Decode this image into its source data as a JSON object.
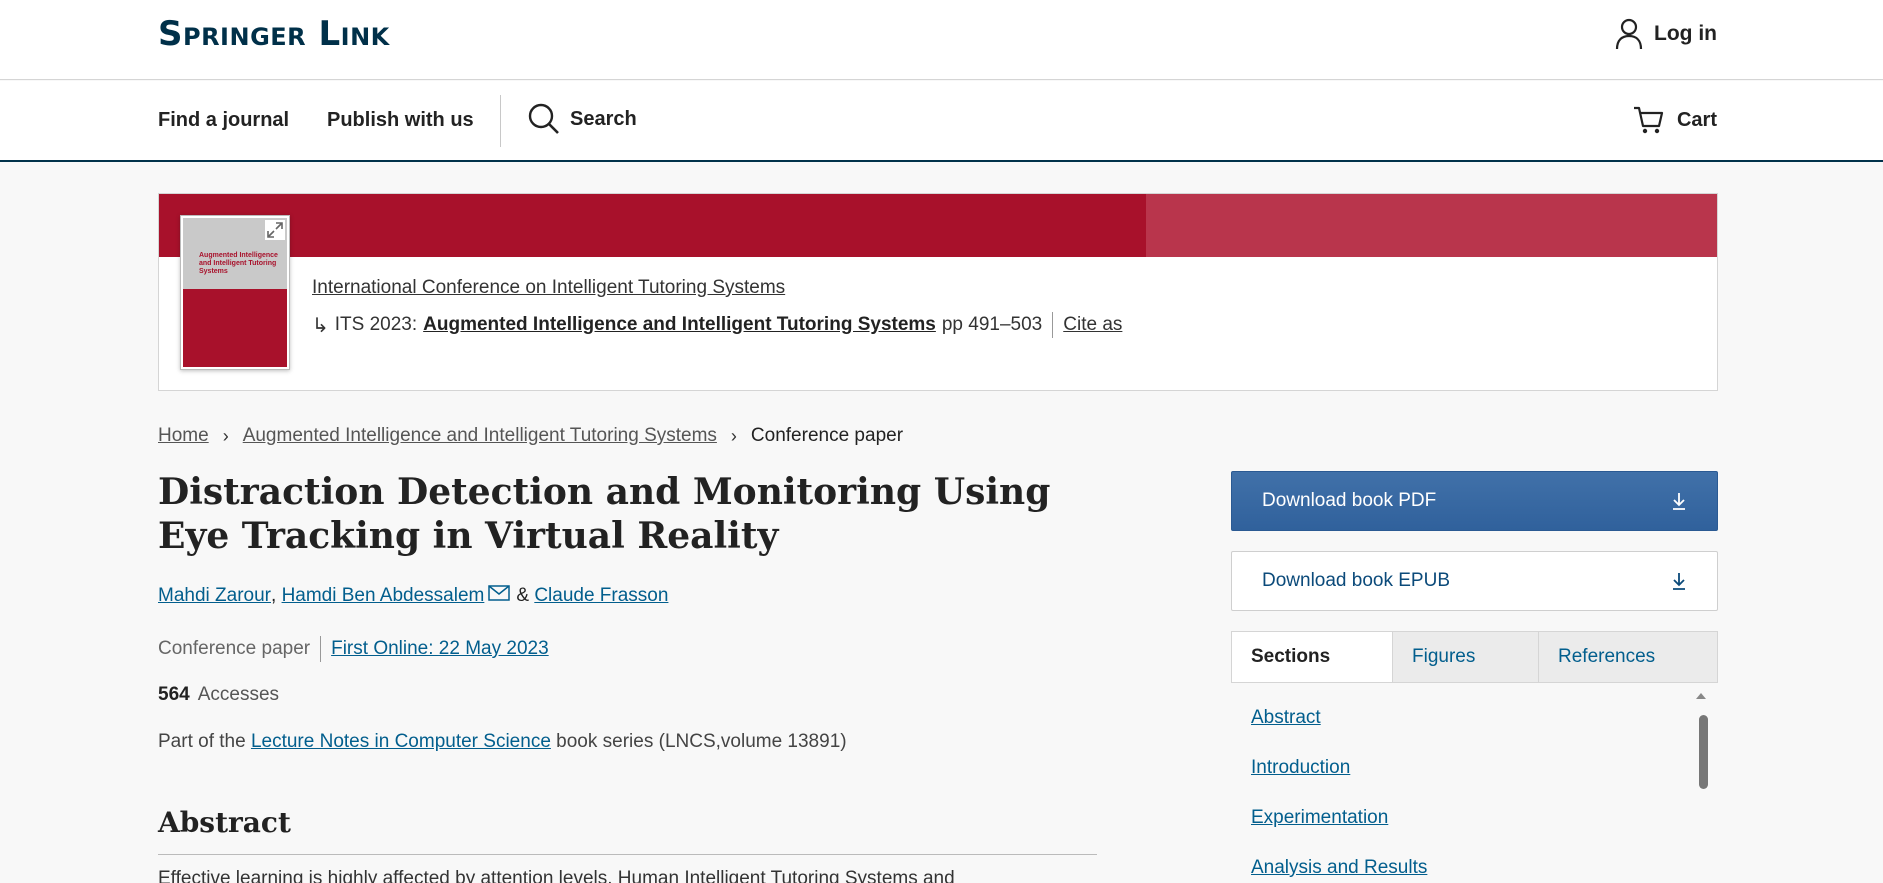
{
  "header": {
    "logo": "Springer Link",
    "login_label": "Log in"
  },
  "nav": {
    "find_journal": "Find a journal",
    "publish": "Publish with us",
    "search": "Search",
    "cart": "Cart"
  },
  "book": {
    "cover_title": "Augmented Intelligence and Intelligent Tutoring Systems",
    "conference": "International Conference on Intelligent Tutoring Systems",
    "prefix": "ITS 2023:",
    "title": "Augmented Intelligence and Intelligent Tutoring Systems",
    "pages": "pp 491–503",
    "cite": "Cite as"
  },
  "breadcrumb": {
    "home": "Home",
    "book": "Augmented Intelligence and Intelligent Tutoring Systems",
    "current": "Conference paper"
  },
  "article": {
    "title": "Distraction Detection and Monitoring Using Eye Tracking in Virtual Reality",
    "authors": [
      "Mahdi Zarour",
      "Hamdi Ben Abdessalem",
      "Claude Frasson"
    ],
    "author_sep": ",",
    "and": "&",
    "type": "Conference paper",
    "first_online": "First Online: 22 May 2023",
    "accesses_count": "564",
    "accesses_label": "Accesses",
    "series_pre": "Part of the",
    "series_link": "Lecture Notes in Computer Science",
    "series_post": "book series (LNCS,volume 13891)",
    "abstract_heading": "Abstract",
    "abstract_text": "Effective learning is highly affected by attention levels. Human Intelligent Tutoring Systems and"
  },
  "sidebar": {
    "download_pdf": "Download book PDF",
    "download_epub": "Download book EPUB",
    "tabs": [
      "Sections",
      "Figures",
      "References"
    ],
    "sections": [
      "Abstract",
      "Introduction",
      "Experimentation",
      "Analysis and Results"
    ]
  },
  "colors": {
    "brand_navy": "#003049",
    "banner_red": "#a8112b",
    "link_blue": "#025e8d",
    "button_blue": "#3a6aa5"
  }
}
